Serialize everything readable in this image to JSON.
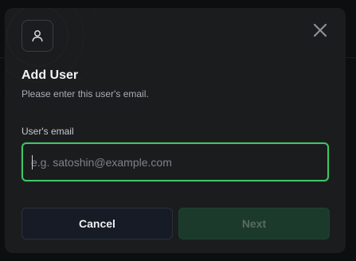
{
  "modal": {
    "title": "Add User",
    "subtitle": "Please enter this user's email.",
    "header_icon": "user-icon",
    "close_icon": "close-icon"
  },
  "form": {
    "email_label": "User's email",
    "email_value": "",
    "email_placeholder": "e.g. satoshin@example.com",
    "focused": true
  },
  "actions": {
    "cancel_label": "Cancel",
    "next_label": "Next",
    "next_disabled": true
  },
  "colors": {
    "focus_ring": "#3fc565",
    "primary_disabled_bg": "#1b3a2b",
    "secondary_bg": "#161b25",
    "modal_bg": "#1b1c1e"
  }
}
